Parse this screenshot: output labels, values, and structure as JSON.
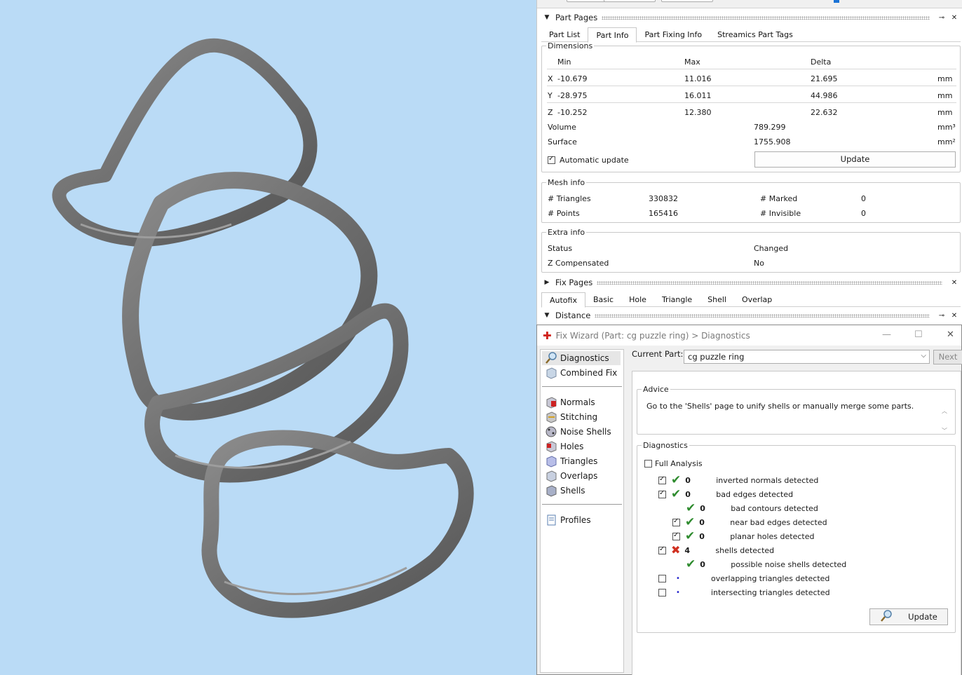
{
  "part_pages": {
    "title": "Part Pages",
    "tabs": [
      "Part List",
      "Part Info",
      "Part Fixing Info",
      "Streamics Part Tags"
    ],
    "active_tab": "Part Info"
  },
  "dimensions": {
    "legend": "Dimensions",
    "headers": [
      "Min",
      "Max",
      "Delta"
    ],
    "rows": [
      {
        "axis": "X",
        "min": "-10.679",
        "max": "11.016",
        "delta": "21.695",
        "unit": "mm"
      },
      {
        "axis": "Y",
        "min": "-28.975",
        "max": "16.011",
        "delta": "44.986",
        "unit": "mm"
      },
      {
        "axis": "Z",
        "min": "-10.252",
        "max": "12.380",
        "delta": "22.632",
        "unit": "mm"
      }
    ],
    "volume_label": "Volume",
    "volume_value": "789.299",
    "volume_unit": "mm³",
    "surface_label": "Surface",
    "surface_value": "1755.908",
    "surface_unit": "mm²",
    "auto_update_label": "Automatic update",
    "update_label": "Update"
  },
  "mesh_info": {
    "legend": "Mesh info",
    "triangles_label": "# Triangles",
    "triangles_value": "330832",
    "points_label": "# Points",
    "points_value": "165416",
    "marked_label": "# Marked",
    "marked_value": "0",
    "invisible_label": "# Invisible",
    "invisible_value": "0"
  },
  "extra_info": {
    "legend": "Extra info",
    "status_label": "Status",
    "status_value": "Changed",
    "zcomp_label": "Z Compensated",
    "zcomp_value": "No"
  },
  "fix_pages": {
    "title": "Fix Pages",
    "tabs": [
      "Autofix",
      "Basic",
      "Hole",
      "Triangle",
      "Shell",
      "Overlap"
    ],
    "active_tab": "Autofix"
  },
  "distance": {
    "title": "Distance"
  },
  "wizard": {
    "title": "Fix Wizard (Part: cg puzzle ring) > Diagnostics",
    "side_top": [
      "Diagnostics",
      "Combined Fix"
    ],
    "side_mid": [
      "Normals",
      "Stitching",
      "Noise Shells",
      "Holes",
      "Triangles",
      "Overlaps",
      "Shells"
    ],
    "side_bottom": [
      "Profiles"
    ],
    "current_part_label": "Current Part:",
    "current_part_value": "cg puzzle ring",
    "next_label": "Next",
    "advice_legend": "Advice",
    "advice_text": "Go to the 'Shells' page to unify shells or manually merge some parts.",
    "diagnostics_legend": "Diagnostics",
    "full_analysis_label": "Full Analysis",
    "items": [
      {
        "checked": true,
        "status": "ok",
        "count": "0",
        "label": "inverted normals detected",
        "indent": 0,
        "has_box": true
      },
      {
        "checked": true,
        "status": "ok",
        "count": "0",
        "label": "bad edges detected",
        "indent": 0,
        "has_box": true
      },
      {
        "checked": false,
        "status": "ok",
        "count": "0",
        "label": "bad contours detected",
        "indent": 1,
        "has_box": false
      },
      {
        "checked": true,
        "status": "ok",
        "count": "0",
        "label": "near bad edges detected",
        "indent": 1,
        "has_box": true
      },
      {
        "checked": true,
        "status": "ok",
        "count": "0",
        "label": "planar holes detected",
        "indent": 1,
        "has_box": true
      },
      {
        "checked": true,
        "status": "error",
        "count": "4",
        "label": "shells detected",
        "indent": 0,
        "has_box": true
      },
      {
        "checked": false,
        "status": "ok",
        "count": "0",
        "label": "possible noise shells detected",
        "indent": 1,
        "has_box": false
      },
      {
        "checked": false,
        "status": "none",
        "count": "",
        "label": "overlapping triangles detected",
        "indent": 0,
        "has_box": true
      },
      {
        "checked": false,
        "status": "none",
        "count": "",
        "label": "intersecting triangles detected",
        "indent": 0,
        "has_box": true
      }
    ],
    "update_label": "Update"
  },
  "colors": {
    "viewport_bg": "#badbf6",
    "ring": "#6f6f6f",
    "ok": "#2e8b2e",
    "error": "#d03020"
  }
}
